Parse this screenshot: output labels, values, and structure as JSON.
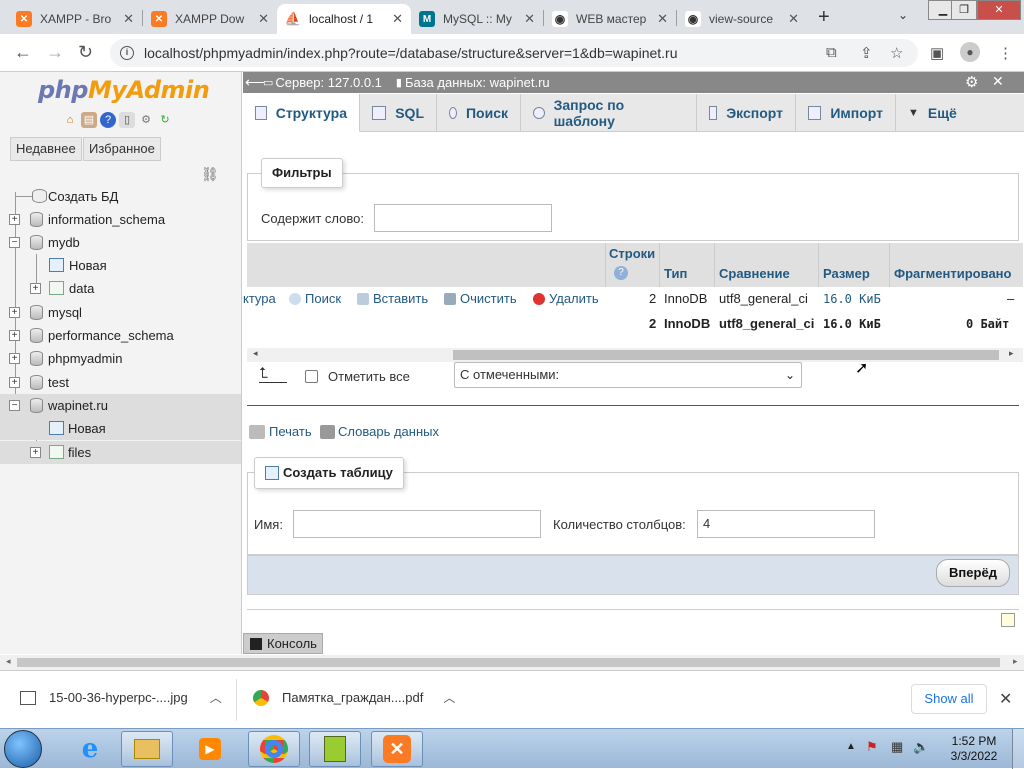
{
  "browser": {
    "tabs": [
      {
        "title": "XAMPP - Bro",
        "icon": "xampp-icon",
        "color": "#fb7a24"
      },
      {
        "title": "XAMPP Dow",
        "icon": "xampp-icon",
        "color": "#fb7a24"
      },
      {
        "title": "localhost / 1",
        "icon": "pma-sail-icon",
        "color": "#f29d0d"
      },
      {
        "title": "MySQL :: My",
        "icon": "mysql-icon",
        "color": "#00758f"
      },
      {
        "title": "WEB мастер",
        "icon": "eye-icon",
        "color": "#333333"
      },
      {
        "title": "view-source",
        "icon": "eye-icon",
        "color": "#333333"
      }
    ],
    "new_tab": "+",
    "url": "localhost/phpmyadmin/index.php?route=/database/structure&server=1&db=wapinet.ru"
  },
  "pma": {
    "logo_php": "php",
    "logo_myadmin": "MyAdmin",
    "recent_label": "Недавнее",
    "favorites_label": "Избранное",
    "tree": {
      "create_db": "Создать БД",
      "items": [
        {
          "name": "information_schema"
        },
        {
          "name": "mydb"
        },
        {
          "name": "Новая"
        },
        {
          "name": "data"
        },
        {
          "name": "mysql"
        },
        {
          "name": "performance_schema"
        },
        {
          "name": "phpmyadmin"
        },
        {
          "name": "test"
        },
        {
          "name": "wapinet.ru"
        },
        {
          "name": "Новая"
        },
        {
          "name": "files"
        }
      ]
    },
    "breadcrumb": {
      "server": "Сервер: 127.0.0.1",
      "database": "База данных: wapinet.ru"
    },
    "tabs": [
      {
        "label": "Структура"
      },
      {
        "label": "SQL"
      },
      {
        "label": "Поиск"
      },
      {
        "label": "Запрос по шаблону"
      },
      {
        "label": "Экспорт"
      },
      {
        "label": "Импорт"
      },
      {
        "label": "Ещё"
      }
    ],
    "filters": {
      "legend": "Фильтры",
      "contains_label": "Содержит слово:",
      "contains_value": ""
    },
    "table": {
      "headers": {
        "rows": "Строки",
        "type": "Тип",
        "collation": "Сравнение",
        "size": "Размер",
        "overhead": "Фрагментировано"
      },
      "row": {
        "actions": [
          "ктура",
          "Поиск",
          "Вставить",
          "Очистить",
          "Удалить"
        ],
        "rows": "2",
        "type": "InnoDB",
        "collation": "utf8_general_ci",
        "size": "16.0 КиБ",
        "overhead": "–"
      },
      "summary": {
        "rows": "2",
        "type": "InnoDB",
        "collation": "utf8_general_ci",
        "size": "16.0 КиБ",
        "overhead": "0 Байт"
      },
      "check_all": "Отметить все",
      "with_selected": "С отмеченными:"
    },
    "print_label": "Печать",
    "dictionary_label": "Словарь данных",
    "create_table": {
      "legend": "Создать таблицу",
      "name_label": "Имя:",
      "name_value": "",
      "columns_label": "Количество столбцов:",
      "columns_value": "4",
      "go_label": "Вперёд"
    },
    "console_label": "Консоль"
  },
  "downloads": {
    "items": [
      {
        "name": "15-00-36-hyperpc-....jpg"
      },
      {
        "name": "Памятка_граждан....pdf"
      }
    ],
    "show_all": "Show all"
  },
  "taskbar": {
    "time": "1:52 PM",
    "date": "3/3/2022"
  }
}
